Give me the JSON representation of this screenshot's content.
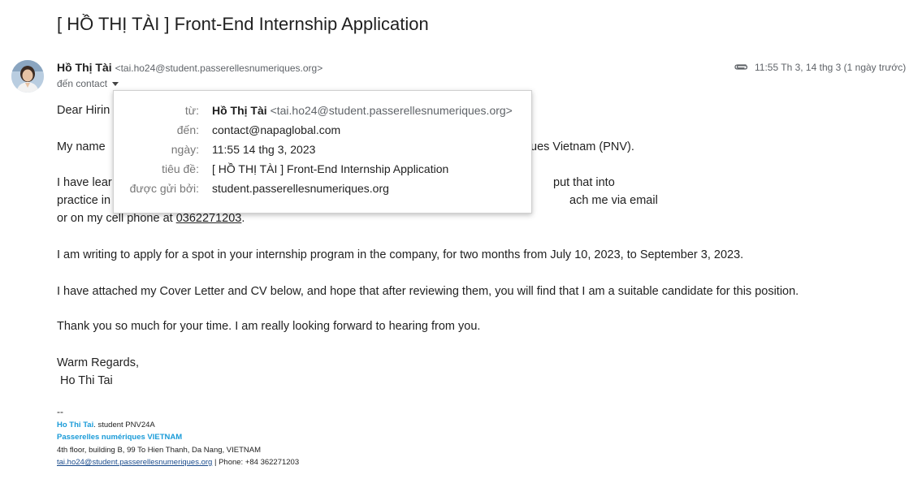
{
  "email": {
    "subject": "[ HỒ THỊ TÀI ] Front-End Internship Application",
    "sender_name": "Hồ Thị Tài",
    "sender_email": "<tai.ho24@student.passerellesnumeriques.org>",
    "to_label": "đến contact",
    "date_display": "11:55 Th 3, 14 thg 3 (1 ngày trước)"
  },
  "body": {
    "greeting": "Dear Hirin",
    "line2_start": "My name",
    "line2_end": "ues Vietnam (PNV).",
    "line3_start": "I have lear",
    "line3_end": "put that into",
    "line4_start": "practice in",
    "line4_end": "ach me via email",
    "line5_prefix": "or on my cell phone at ",
    "phone": "0362271203",
    "line5_suffix": ".",
    "para_apply": "I am writing to apply for a spot in your internship program in the company, for two months from July 10, 2023, to September 3, 2023.",
    "para_attached": "I have attached my Cover Letter and CV below, and hope that after reviewing them, you will find that I am a suitable candidate for this position.",
    "para_thanks": "Thank you so much for your time. I am really looking forward to hearing from you.",
    "closing": "Warm Regards,",
    "closing_name": "Ho Thi Tai"
  },
  "signature": {
    "dash": "--",
    "name": "Ho Thi Tai",
    "role": ". student PNV24A",
    "org": "Passerelles numériques VIETNAM",
    "address": "4th floor, building B, 99 To Hien Thanh, Da Nang, VIETNAM",
    "email": "tai.ho24@student.passerellesnumeriques.org",
    "phone": " | Phone: +84 362271203"
  },
  "details_popup": {
    "from_label": "từ:",
    "from_name": "Hồ Thị Tài",
    "from_email": "<tai.ho24@student.passerellesnumeriques.org>",
    "to_label": "đến:",
    "to_value": "contact@napaglobal.com",
    "date_label": "ngày:",
    "date_value": "11:55 14 thg 3, 2023",
    "subject_label": "tiêu đề:",
    "subject_value": "[ HỒ THỊ TÀI ] Front-End Internship Application",
    "mailedby_label": "được gửi bởi:",
    "mailedby_value": "student.passerellesnumeriques.org"
  },
  "icons": {
    "attachment": "paperclip-icon",
    "expand": "chevron-down-icon"
  },
  "colors": {
    "signature_accent": "#1a9bd8"
  }
}
